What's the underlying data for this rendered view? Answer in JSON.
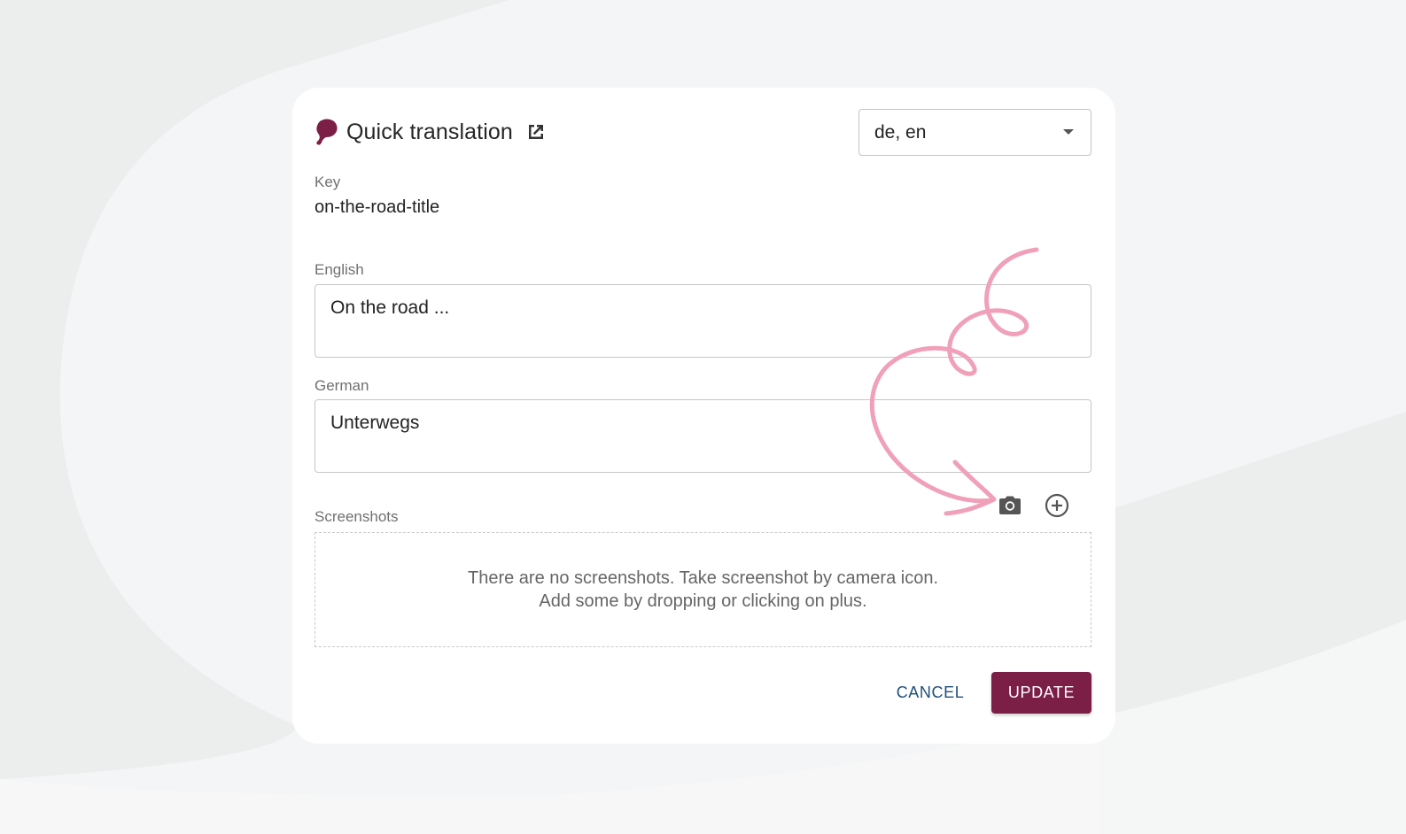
{
  "dialog": {
    "title": "Quick translation",
    "logo_icon": "tolgee-logo-icon",
    "open_external_icon": "open-in-new-icon",
    "language_select": {
      "value": "de, en"
    },
    "key": {
      "label": "Key",
      "value": "on-the-road-title"
    },
    "fields": [
      {
        "label": "English",
        "value": "On the road ..."
      },
      {
        "label": "German",
        "value": "Unterwegs"
      }
    ],
    "screenshots": {
      "label": "Screenshots",
      "camera_icon": "camera-icon",
      "add_icon": "add-circle-icon",
      "empty_line1": "There are no screenshots. Take screenshot by camera icon.",
      "empty_line2": "Add some by dropping or clicking on plus."
    },
    "actions": {
      "cancel": "CANCEL",
      "update": "UPDATE"
    }
  },
  "colors": {
    "accent": "#7b1f47",
    "link": "#1f4f7a",
    "annotation_arrow": "#f0a0b8",
    "background": "#f3f4f5"
  }
}
